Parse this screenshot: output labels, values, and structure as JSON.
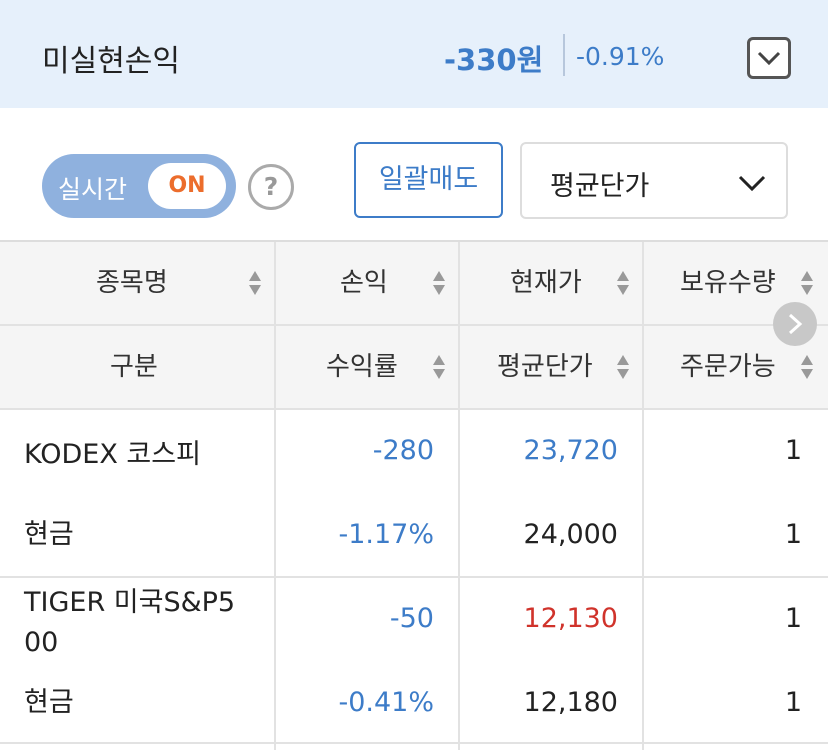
{
  "summary": {
    "label": "미실현손익",
    "amount": "-330원",
    "rate": "-0.91%"
  },
  "controls": {
    "realtime_label": "실시간",
    "realtime_state": "ON",
    "help_glyph": "?",
    "bulk_sell_label": "일괄매도",
    "sort_select_value": "평균단가"
  },
  "table": {
    "headers_top": [
      "종목명",
      "손익",
      "현재가",
      "보유수량"
    ],
    "headers_bottom": [
      "구분",
      "수익률",
      "평균단가",
      "주문가능"
    ],
    "rows": [
      {
        "name": "KODEX 코스피",
        "type": "현금",
        "pnl": "-280",
        "pnl_rate": "-1.17%",
        "current_price": "23,720",
        "avg_price": "24,000",
        "holding_qty": "1",
        "orderable_qty": "1"
      },
      {
        "name_line1": "TIGER 미국S&P5",
        "name_line2": "00",
        "type": "현금",
        "pnl": "-50",
        "pnl_rate": "-0.41%",
        "current_price": "12,130",
        "avg_price": "12,180",
        "holding_qty": "1",
        "orderable_qty": "1"
      }
    ]
  },
  "colors": {
    "accent_blue": "#3d7cc8",
    "down_red": "#d0332b",
    "realtime_orange": "#ec6d2c",
    "summary_bg": "#e6f0fb"
  },
  "icons": {
    "summary_toggle": "chevron-down-icon",
    "select_arrow": "chevron-down-icon",
    "scroll_right": "chevron-right-icon",
    "sort": "sort-arrows-icon",
    "help": "question-circle-icon"
  }
}
